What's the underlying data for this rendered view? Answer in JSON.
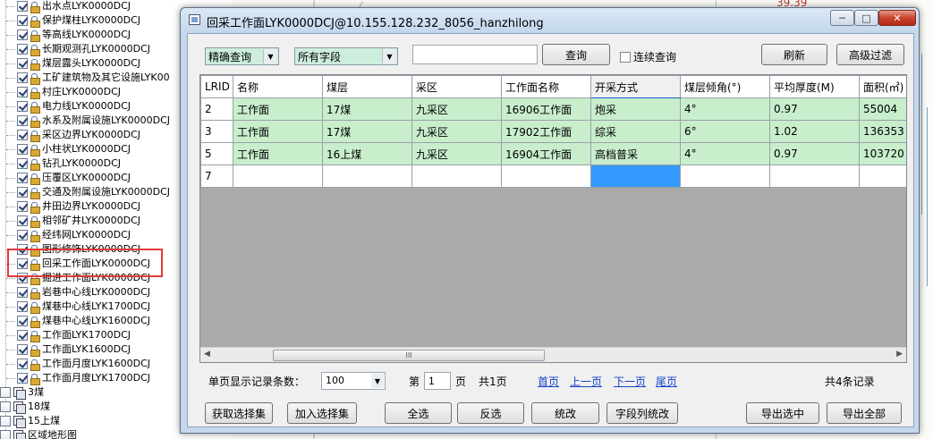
{
  "tree": {
    "layers": [
      {
        "label": "出水点LYK0000DCJ"
      },
      {
        "label": "保护煤柱LYK0000DCJ"
      },
      {
        "label": "等高线LYK0000DCJ"
      },
      {
        "label": "长期观测孔LYK0000DCJ"
      },
      {
        "label": "煤层露头LYK0000DCJ"
      },
      {
        "label": "工矿建筑物及其它设施LYK00"
      },
      {
        "label": "村庄LYK0000DCJ"
      },
      {
        "label": "电力线LYK0000DCJ"
      },
      {
        "label": "水系及附属设施LYK0000DCJ"
      },
      {
        "label": "采区边界LYK0000DCJ"
      },
      {
        "label": "小柱状LYK0000DCJ"
      },
      {
        "label": "钻孔LYK0000DCJ"
      },
      {
        "label": "压覆区LYK0000DCJ"
      },
      {
        "label": "交通及附属设施LYK0000DCJ"
      },
      {
        "label": "井田边界LYK0000DCJ"
      },
      {
        "label": "相邻矿井LYK0000DCJ"
      },
      {
        "label": "经纬网LYK0000DCJ"
      },
      {
        "label": "图形修饰LYK0000DCJ"
      },
      {
        "label": "回采工作面LYK0000DCJ"
      },
      {
        "label": "掘进工作面LYK0000DCJ"
      },
      {
        "label": "岩巷中心线LYK0000DCJ"
      },
      {
        "label": "煤巷中心线LYK1700DCJ"
      },
      {
        "label": "煤巷中心线LYK1600DCJ"
      },
      {
        "label": "工作面LYK1700DCJ"
      },
      {
        "label": "工作面LYK1600DCJ"
      },
      {
        "label": "工作面月度LYK1600DCJ"
      },
      {
        "label": "工作面月度LYK1700DCJ"
      }
    ],
    "groups": [
      {
        "label": "3煤"
      },
      {
        "label": "18煤"
      },
      {
        "label": "15上煤"
      },
      {
        "label": "区域地形图"
      }
    ]
  },
  "map": {
    "fragment_text": "39.39"
  },
  "window": {
    "title": "回采工作面LYK0000DCJ@10.155.128.232_8056_hanzhilong",
    "min_label": "─",
    "max_label": "□",
    "close_label": "✕"
  },
  "toolbar": {
    "match_mode": "精确查询",
    "field_select": "所有字段",
    "search_value": "",
    "search_button": "查询",
    "continuous_label": "连续查询",
    "refresh_button": "刷新",
    "advanced_filter_button": "高级过滤"
  },
  "grid": {
    "columns": [
      "LRID",
      "名称",
      "煤层",
      "采区",
      "工作面名称",
      "开采方式",
      "煤层倾角(°)",
      "平均厚度(M)",
      "面积(㎡)"
    ],
    "rows": [
      [
        "2",
        "工作面",
        "17煤",
        "九采区",
        "16906工作面",
        "炮采",
        "4°",
        "0.97",
        "55004"
      ],
      [
        "3",
        "工作面",
        "17煤",
        "九采区",
        "17902工作面",
        "综采",
        "6°",
        "1.02",
        "136353"
      ],
      [
        "5",
        "工作面",
        "16上煤",
        "九采区",
        "16904工作面",
        "高档普采",
        "4°",
        "0.97",
        "103720"
      ]
    ],
    "new_row_id": "7",
    "scroll_grip": "III"
  },
  "pager": {
    "page_size_label": "单页显示记录条数：",
    "page_size": "100",
    "page_prefix": "第",
    "page_value": "1",
    "page_suffix": "页",
    "total_pages": "共1页",
    "first": "首页",
    "prev": "上一页",
    "next": "下一页",
    "last": "尾页",
    "total_records": "共4条记录"
  },
  "actions": {
    "get_selection": "获取选择集",
    "add_selection": "加入选择集",
    "select_all": "全选",
    "invert": "反选",
    "stats": "统改",
    "field_stats": "字段列统改",
    "export_selected": "导出选中",
    "export_all": "导出全部"
  },
  "colors": {
    "row_background": "#c8eecc",
    "active_cell": "#3399ff",
    "grid_empty": "#aaaaaa",
    "link": "#1542c9",
    "highlight_box": "#e53935"
  }
}
